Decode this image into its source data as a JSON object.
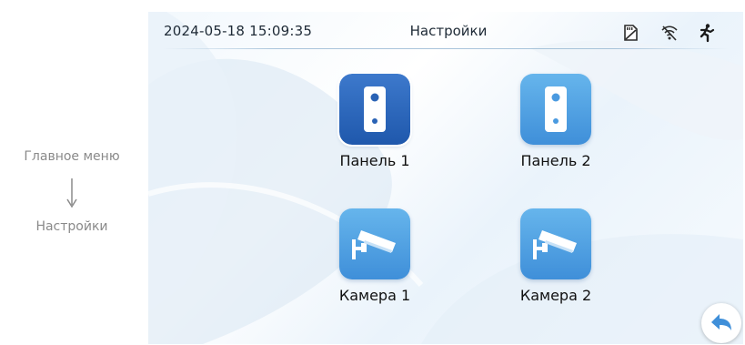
{
  "breadcrumb": {
    "from": "Главное меню",
    "to": "Настройки"
  },
  "status_bar": {
    "datetime": "2024-05-18 15:09:35",
    "title": "Настройки",
    "icons": [
      "sd-card-icon",
      "wifi-icon",
      "motion-detection-icon"
    ]
  },
  "menu": {
    "items": [
      {
        "label": "Панель 1",
        "icon": "door-panel-icon",
        "selected": true
      },
      {
        "label": "Панель 2",
        "icon": "door-panel-icon",
        "selected": false
      },
      {
        "label": "Камера 1",
        "icon": "cctv-camera-icon",
        "selected": false
      },
      {
        "label": "Камера 2",
        "icon": "cctv-camera-icon",
        "selected": false
      }
    ]
  },
  "back_button": {
    "icon": "back-arrow-icon"
  },
  "colors": {
    "tile_selected": "#2a63b5",
    "tile_normal": "#4a9ae0",
    "text": "#1e2a36"
  }
}
